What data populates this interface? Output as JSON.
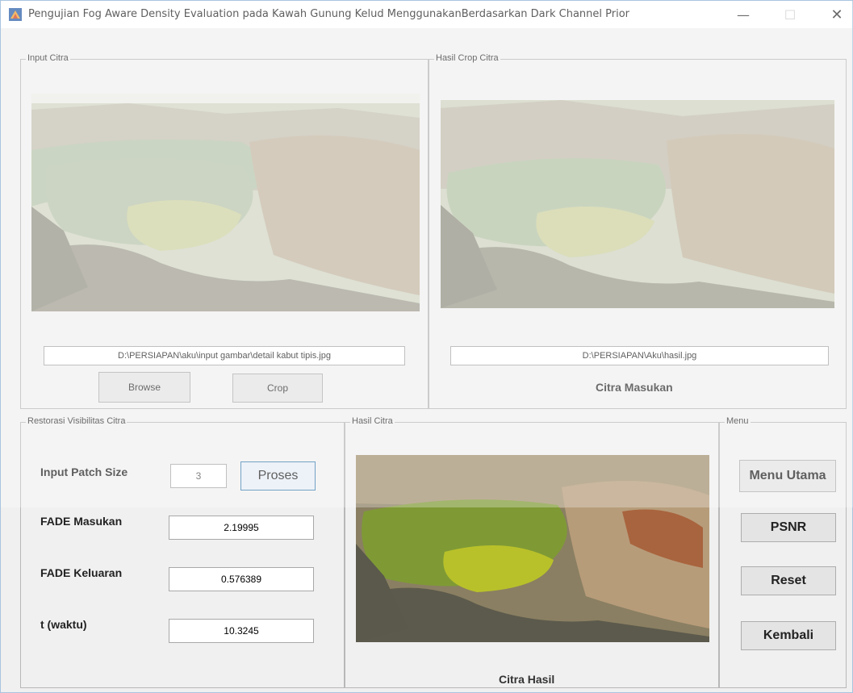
{
  "window": {
    "title": "Pengujian  Fog Aware Density Evaluation  pada Kawah Gunung Kelud MenggunakanBerdasarkan Dark Channel Prior",
    "minimize_glyph": "—",
    "maximize_glyph": "☐",
    "close_glyph": "✕"
  },
  "input_panel": {
    "title": "Input Citra",
    "path": "D:\\PERSIAPAN\\aku\\input gambar\\detail kabut tipis.jpg",
    "browse_label": "Browse",
    "crop_label": "Crop"
  },
  "crop_panel": {
    "title": "Hasil Crop Citra",
    "path": "D:\\PERSIAPAN\\Aku\\hasil.jpg",
    "caption": "Citra Masukan"
  },
  "restore_panel": {
    "title": "Restorasi Visibilitas Citra",
    "patch_label": "Input Patch Size",
    "patch_value": "3",
    "proses_label": "Proses",
    "fade_in_label": "FADE Masukan",
    "fade_in_value": "2.19995",
    "fade_out_label": "FADE Keluaran",
    "fade_out_value": "0.576389",
    "time_label": "t (waktu)",
    "time_value": "10.3245"
  },
  "result_panel": {
    "title": "Hasil  Citra",
    "caption": "Citra Hasil"
  },
  "menu_panel": {
    "title": "Menu",
    "menu_utama_label": "Menu Utama",
    "psnr_label": "PSNR",
    "reset_label": "Reset",
    "kembali_label": "Kembali"
  },
  "colors": {
    "window_bg": "#f0f0f0",
    "lake_foggy": "#b9c79a",
    "lake_clear": "#9fb43a"
  }
}
